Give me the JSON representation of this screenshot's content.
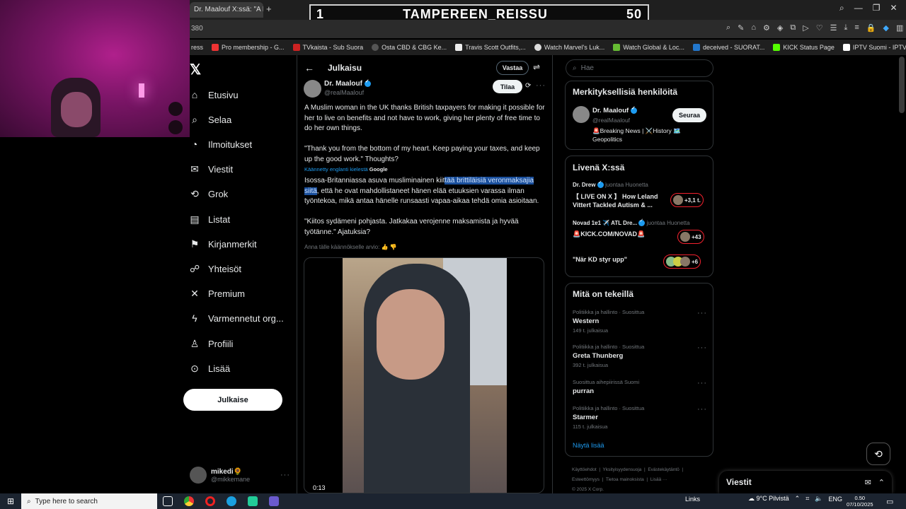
{
  "overlay": {
    "left_number": "1",
    "title": "TAMPEREEN_REISSU",
    "right_number": "50"
  },
  "browser": {
    "tab_title": "Dr. Maalouf X:ssä: \"A Mu",
    "url_fragment": "380",
    "bookmarks": [
      "ress",
      "Pro membership - G...",
      "TVkaista - Sub Suora",
      "Osta CBD & CBG Ke...",
      "Travis Scott Outfits,...",
      "Watch Marvel's Luk...",
      "Watch Global & Loc...",
      "deceived - SUORAT...",
      "KICK Status Page",
      "IPTV Suomi - IPTV v..."
    ]
  },
  "leftnav": {
    "items": [
      {
        "label": "Etusivu",
        "icon": "home-icon"
      },
      {
        "label": "Selaa",
        "icon": "search-icon"
      },
      {
        "label": "Ilmoitukset",
        "icon": "bell-icon"
      },
      {
        "label": "Viestit",
        "icon": "mail-icon"
      },
      {
        "label": "Grok",
        "icon": "grok-icon"
      },
      {
        "label": "Listat",
        "icon": "list-icon"
      },
      {
        "label": "Kirjanmerkit",
        "icon": "bookmark-icon"
      },
      {
        "label": "Yhteisöt",
        "icon": "communities-icon"
      },
      {
        "label": "Premium",
        "icon": "x-icon"
      },
      {
        "label": "Varmennetut org...",
        "icon": "lightning-icon"
      },
      {
        "label": "Profiili",
        "icon": "profile-icon"
      },
      {
        "label": "Lisää",
        "icon": "more-icon"
      }
    ],
    "post_button": "Julkaise",
    "account_name": "mikedi🌻",
    "account_handle": "@mikkemane"
  },
  "center": {
    "header_title": "Julkaisu",
    "reply_button": "Vastaa",
    "author_name": "Dr. Maalouf",
    "author_handle": "@realMaalouf",
    "subscribe_button": "Tilaa",
    "text_en_1": "A Muslim woman in the UK thanks British taxpayers for making it possible for her to live on benefits and not have to work, giving her plenty of free time to do her own things.",
    "text_en_2": "\"Thank you from the bottom of my heart. Keep paying your taxes, and keep up the good work.\" Thoughts?",
    "translated_from": "Käännetty englanti kielestä",
    "translated_by": "Google",
    "fi_part1": "Isossa-Britanniassa asuva musliminainen kiit",
    "fi_highlight1": "tää brittiläisiä veronmaksajia",
    "fi_highlight2": "siitä",
    "fi_part2": ", että he ovat mahdollistaneet hänen elää etuuksien varassa ilman työntekoa, mikä antaa hänelle runsaasti vapaa-aikaa tehdä omia asioitaan.",
    "text_fi_2": "\"Kiitos sydämeni pohjasta. Jatkakaa verojenne maksamista ja hyvää työtänne.\" Ajatuksia?",
    "rate_translation": "Anna tälle käännökselle arvio:",
    "video_duration": "0:13"
  },
  "right": {
    "search_placeholder": "Hae",
    "relevant_title": "Merkityksellisiä henkilöitä",
    "relevant_name": "Dr. Maalouf",
    "relevant_handle": "@realMaalouf",
    "relevant_bio": "🚨Breaking News | ⚔️History 🗺️ Geopolitics",
    "follow_button": "Seuraa",
    "live_title": "Livenä X:ssä",
    "live": [
      {
        "host": "Dr. Drew",
        "status": "juontaa Huonetta",
        "title": "【 LIVE ON X 】 How Leland Vittert Tackled Autism & ...",
        "count": "+3,1 t."
      },
      {
        "host": "Novad 1ɐ1 ✈️ ATL Dre...",
        "status": "juontaa Huonetta",
        "title": "🚨KICK.COM/NOVAD🚨",
        "count": "+43"
      },
      {
        "host": "",
        "status": "",
        "title": "\"När KD styr upp\"",
        "count": "+6"
      }
    ],
    "trends_title": "Mitä on tekeillä",
    "trends": [
      {
        "meta": "Politiikka ja hallinto · Suosittua",
        "name": "Western",
        "posts": "149 t. julkaisua"
      },
      {
        "meta": "Politiikka ja hallinto · Suosittua",
        "name": "Greta Thunberg",
        "posts": "392 t. julkaisua"
      },
      {
        "meta": "Suosittua aihepiirissä Suomi",
        "name": "purran",
        "posts": ""
      },
      {
        "meta": "Politiikka ja hallinto · Suosittua",
        "name": "Starmer",
        "posts": "115 t. julkaisua"
      }
    ],
    "show_more": "Näytä lisää",
    "footer_links": [
      "Käyttöehdot",
      "Yksityisyydensuoja",
      "Evästekäytäntö",
      "Esteettömyys",
      "Tietoa mainoksista",
      "Lisää ···",
      "© 2025 X Corp."
    ],
    "messages_title": "Viestit"
  },
  "taskbar": {
    "search_placeholder": "Type here to search",
    "links": "Links",
    "weather": "9°C  Pilvistä",
    "language": "ENG",
    "time": "0.50",
    "date": "07/10/2025"
  },
  "colors": {
    "accent": "#1d9bf0",
    "highlight": "#1a4f9c",
    "live_border": "#f4212e"
  }
}
